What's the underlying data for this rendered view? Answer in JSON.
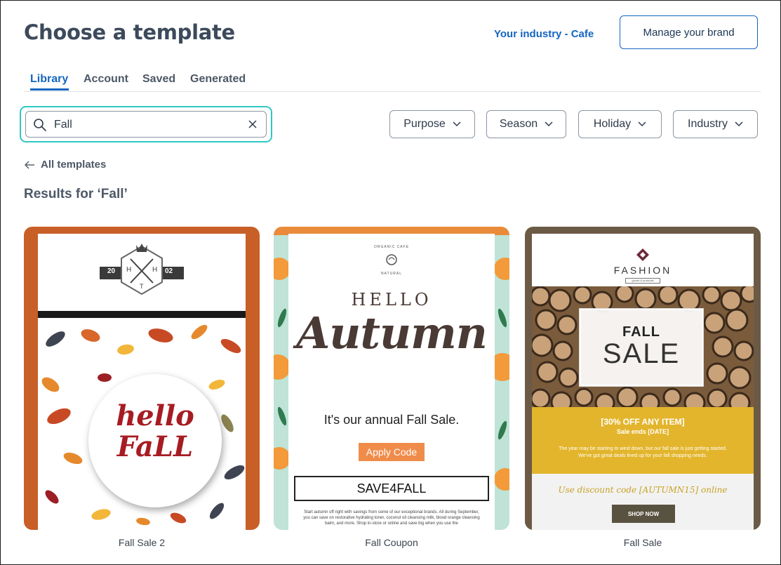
{
  "header": {
    "title": "Choose a template",
    "industry_link": "Your industry - Cafe",
    "brand_button": "Manage your brand"
  },
  "tabs": [
    {
      "label": "Library",
      "active": true
    },
    {
      "label": "Account",
      "active": false
    },
    {
      "label": "Saved",
      "active": false
    },
    {
      "label": "Generated",
      "active": false
    }
  ],
  "search": {
    "value": "Fall",
    "placeholder": ""
  },
  "filters": [
    {
      "label": "Purpose"
    },
    {
      "label": "Season"
    },
    {
      "label": "Holiday"
    },
    {
      "label": "Industry"
    }
  ],
  "back_link": "All templates",
  "results_heading": "Results for ‘Fall’",
  "colors": {
    "accent": "#1566c0",
    "search_focus": "#2ec8c4"
  },
  "cards": [
    {
      "name": "Fall Sale 2",
      "logo_left": "20",
      "logo_right": "02",
      "logo_letters": [
        "H",
        "H",
        "T"
      ],
      "headline_line1": "hello",
      "headline_line2": "FaLL"
    },
    {
      "name": "Fall Coupon",
      "logo_text": "ORGANIC CAFE",
      "logo_sub": "NATURAL",
      "hello": "HELLO",
      "autumn": "Autumn",
      "tagline": "It's our annual Fall Sale.",
      "button": "Apply Code",
      "code": "SAVE4FALL",
      "fine_print": "Start autumn off right with savings from some of our exceptional brands. All during September, you can save on restorative hydrating toner, coconut oil cleansing milk, blood orange cleansing balm, and more. Shop in-store or online and save big when you use the"
    },
    {
      "name": "Fall Sale",
      "brand": "FASHION",
      "brand_sub": "goods & products",
      "fall": "FALL",
      "sale": "SALE",
      "offer": "[30% OFF ANY ITEM]",
      "ends": "Sale ends [DATE]",
      "body": "The year may be starting to wind down, but our fall sale is just getting started. We've got great deals lined up for your fall shopping needs.",
      "discount": "Use discount code [AUTUMN15] online",
      "button": "SHOP NOW"
    }
  ]
}
